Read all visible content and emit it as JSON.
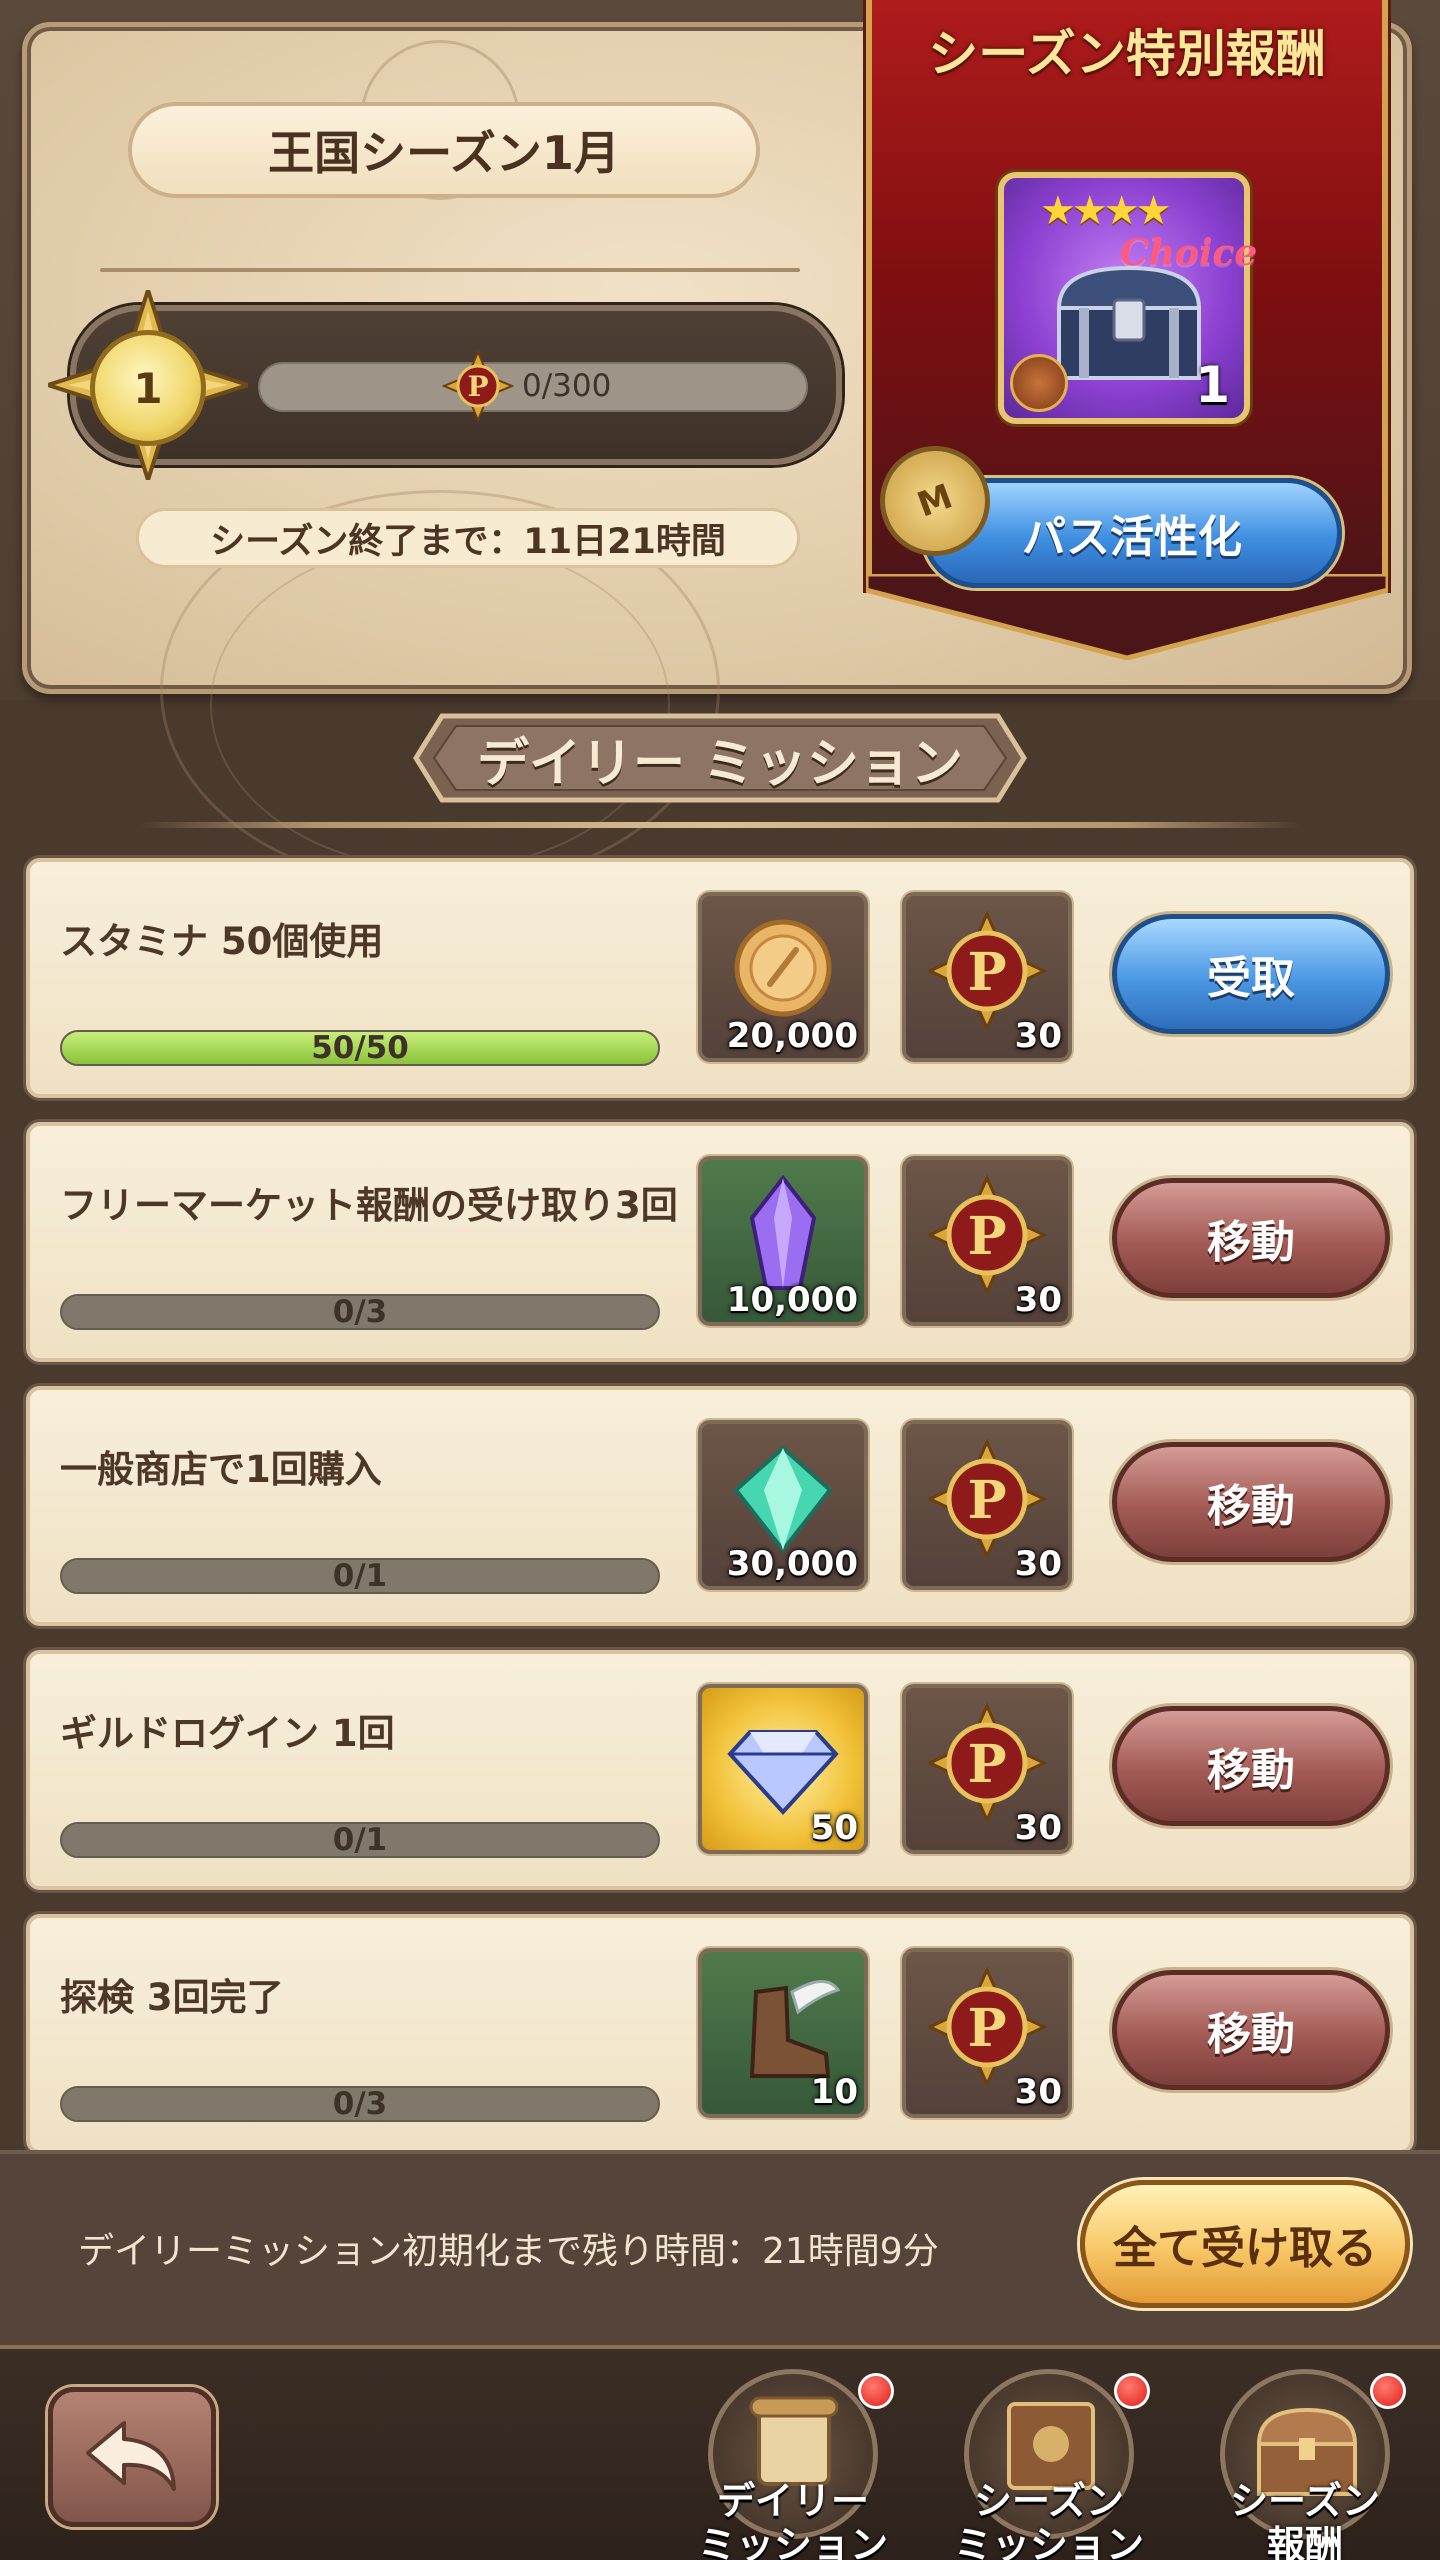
{
  "season": {
    "title": "王国シーズン1月",
    "level": "1",
    "progress_text": "0/300",
    "progress_fraction": 0.0,
    "ends_in": "シーズン終了まで：11日21時間"
  },
  "special_reward": {
    "title": "シーズン特別報酬",
    "choice_label": "Choice",
    "stars": "★★★★",
    "count": "1",
    "ticket_letter": "M",
    "pass_button": "パス活性化"
  },
  "section": {
    "title": "デイリー ミッション"
  },
  "missions": [
    {
      "title": "スタミナ 50個使用",
      "progress": "50/50",
      "fraction": 1.0,
      "item_icon": "gold-coin-icon",
      "item_count": "20,000",
      "points": "30",
      "button": "受取",
      "button_type": "claim"
    },
    {
      "title": "フリーマーケット報酬の受け取り3回",
      "progress": "0/3",
      "fraction": 0.0,
      "item_icon": "purple-crystal-icon",
      "item_count": "10,000",
      "points": "30",
      "button": "移動",
      "button_type": "move"
    },
    {
      "title": "一般商店で1回購入",
      "progress": "0/1",
      "fraction": 0.0,
      "item_icon": "green-gem-icon",
      "item_count": "30,000",
      "points": "30",
      "button": "移動",
      "button_type": "move"
    },
    {
      "title": "ギルドログイン 1回",
      "progress": "0/1",
      "fraction": 0.0,
      "item_icon": "diamond-icon",
      "item_count": "50",
      "points": "30",
      "button": "移動",
      "button_type": "move"
    },
    {
      "title": "探検 3回完了",
      "progress": "0/3",
      "fraction": 0.0,
      "item_icon": "winged-boot-icon",
      "item_count": "10",
      "points": "30",
      "button": "移動",
      "button_type": "move"
    }
  ],
  "footer": {
    "reset_text": "デイリーミッション初期化まで残り時間：21時間9分",
    "claim_all": "全て受け取る"
  },
  "nav": {
    "tabs": [
      {
        "label_line1": "デイリー",
        "label_line2": "ミッション"
      },
      {
        "label_line1": "シーズン",
        "label_line2": "ミッション"
      },
      {
        "label_line1": "シーズン",
        "label_line2": "報酬"
      }
    ]
  },
  "colors": {
    "claim_button": "#4b98e4",
    "move_button": "#a25a54",
    "progress_fill": "#8cc43a",
    "notification": "#e0201a"
  }
}
